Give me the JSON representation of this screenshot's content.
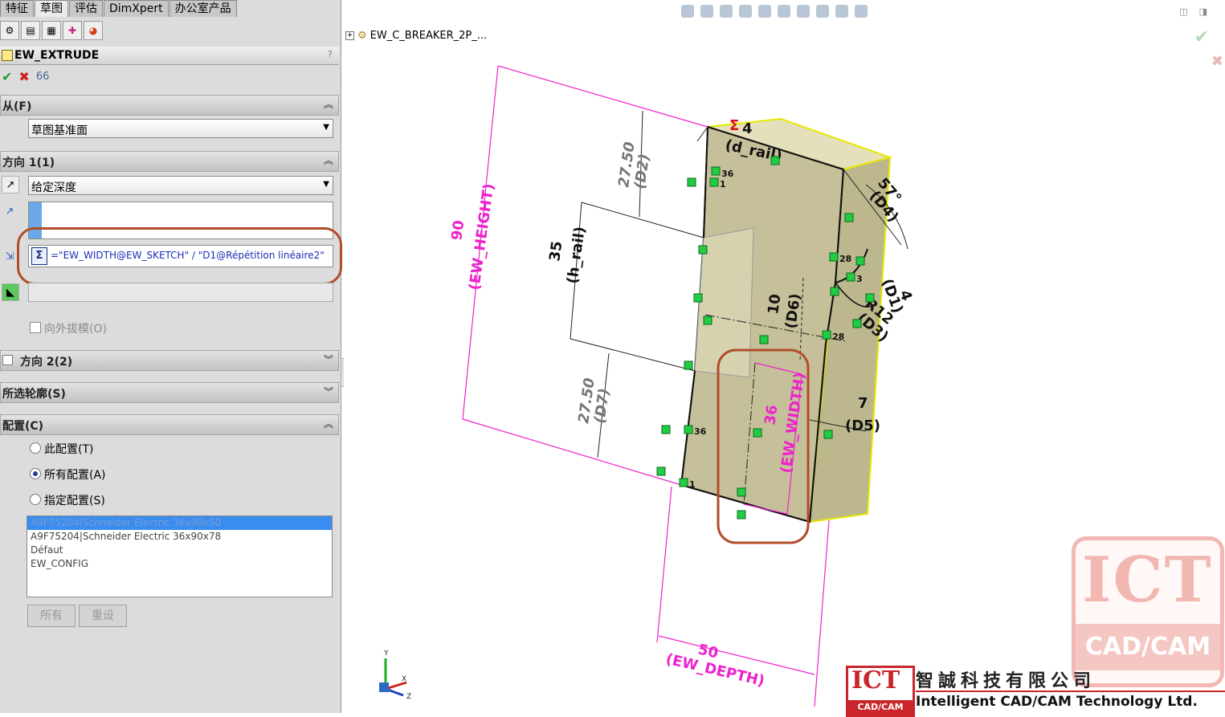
{
  "tabs": [
    "特征",
    "草图",
    "评估",
    "DimXpert",
    "办公室产品"
  ],
  "icon_tabs": [
    "feature-manager-icon",
    "property-manager-icon",
    "configuration-manager-icon",
    "dimxpert-manager-icon",
    "display-manager-icon"
  ],
  "pm": {
    "title": "EW_EXTRUDE",
    "help": "?",
    "ok": "✔",
    "cancel": "✖",
    "preview": "66"
  },
  "from": {
    "header": "从(F)",
    "value": "草图基准面"
  },
  "direction1": {
    "header": "方向 1(1)",
    "end_condition": "给定深度",
    "equation": "=\"EW_WIDTH@EW_SKETCH\" / \"D1@Répétition linéaire2\"",
    "draft_label": "向外拔模(O)"
  },
  "direction2": {
    "header": "方向 2(2)"
  },
  "selected_contours": {
    "header": "所选轮廓(S)"
  },
  "configurations": {
    "header": "配置(C)",
    "options": [
      "此配置(T)",
      "所有配置(A)",
      "指定配置(S)"
    ],
    "selected_option": 1,
    "list": [
      "A9F75204|Schneider Electric 36x90x50",
      "A9F75204|Schneider Electric 36x90x78",
      "Défaut",
      "EW_CONFIG"
    ],
    "selected_row": 0,
    "btn_all": "所有",
    "btn_reset": "重设"
  },
  "tree": {
    "root": "EW_C_BREAKER_2P_..."
  },
  "dimensions": {
    "ew_height": [
      "90",
      "(EW_HEIGHT)"
    ],
    "d2": [
      "27.50",
      "(D2)"
    ],
    "h_rail": [
      "35",
      "(h_rail)"
    ],
    "d7": [
      "27.50",
      "(D7)"
    ],
    "d_rail": [
      "(d_rail)"
    ],
    "sigma4": [
      "Σ",
      "4"
    ],
    "d4": [
      "57°",
      "(D4)"
    ],
    "d1": [
      "4",
      "(D1)"
    ],
    "d3": [
      "R12",
      "(D3)"
    ],
    "d6": [
      "10",
      "(D6)"
    ],
    "ew_width": [
      "36",
      "(EW_WIDTH)"
    ],
    "d5": [
      "7",
      "(D5)"
    ],
    "ew_depth": [
      "50",
      "(EW_DEPTH)"
    ],
    "relations": [
      "36",
      "1",
      "28",
      "3",
      "28",
      "36",
      "1"
    ]
  },
  "triad": {
    "x": "X",
    "y": "Y",
    "z": "Z"
  },
  "watermark": {
    "big": "ICT",
    "big_sub": "CAD/CAM",
    "small": "ICT",
    "small_sub": "CAD/CAM",
    "company_cn": "智誠科技有限公司",
    "company_en": "Intelligent CAD/CAM Technology Ltd."
  },
  "colors": {
    "dimension": "#ee22cc",
    "solid_fill": "#c6c09a",
    "solid_edge": "#e8e800",
    "highlight": "#b14d2a",
    "selection": "#3a8df0",
    "relation": "#22cc44"
  }
}
